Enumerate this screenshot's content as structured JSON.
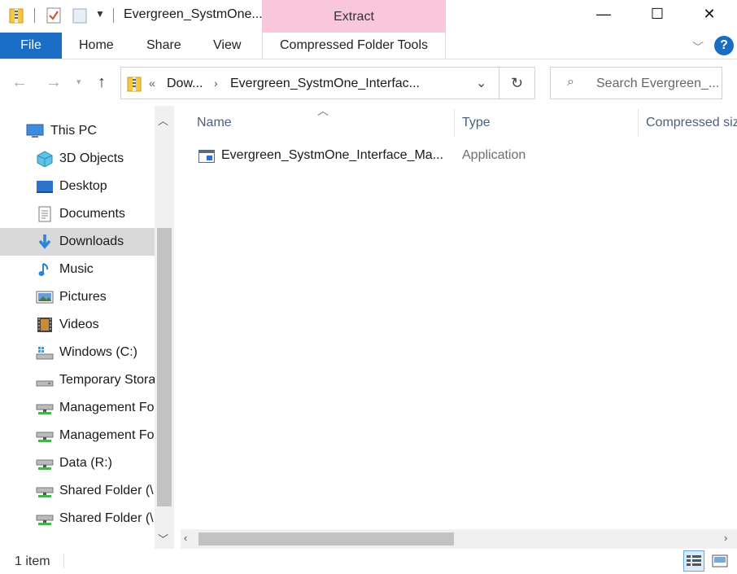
{
  "window": {
    "title": "Evergreen_SystmOne...",
    "contextual_group": "Extract",
    "contextual_color": "#f9c6dc",
    "controls": {
      "minimize": "—",
      "maximize": "☐",
      "close": "✕"
    }
  },
  "ribbon": {
    "file": "File",
    "tabs": [
      "Home",
      "Share",
      "View"
    ],
    "contextual_tab": "Compressed Folder Tools",
    "accent": "#1a6cc5",
    "help": "?"
  },
  "address": {
    "overflow": "«",
    "crumbs": [
      "Dow...",
      "Evergreen_SystmOne_Interfac..."
    ],
    "search_placeholder": "Search Evergreen_..."
  },
  "nav": {
    "items": [
      {
        "label": "This PC",
        "icon": "this-pc-icon"
      },
      {
        "label": "3D Objects",
        "icon": "3d-objects-icon"
      },
      {
        "label": "Desktop",
        "icon": "desktop-icon"
      },
      {
        "label": "Documents",
        "icon": "documents-icon"
      },
      {
        "label": "Downloads",
        "icon": "downloads-icon",
        "selected": true
      },
      {
        "label": "Music",
        "icon": "music-icon"
      },
      {
        "label": "Pictures",
        "icon": "pictures-icon"
      },
      {
        "label": "Videos",
        "icon": "videos-icon"
      },
      {
        "label": "Windows (C:)",
        "icon": "windows-drive-icon"
      },
      {
        "label": "Temporary Stora",
        "icon": "drive-icon"
      },
      {
        "label": "Management Fo",
        "icon": "network-drive-icon"
      },
      {
        "label": "Management Fo",
        "icon": "network-drive-icon"
      },
      {
        "label": "Data (R:)",
        "icon": "network-drive-icon"
      },
      {
        "label": "Shared Folder (\\",
        "icon": "network-drive-icon"
      },
      {
        "label": "Shared Folder (\\",
        "icon": "network-drive-icon"
      }
    ]
  },
  "content": {
    "columns": [
      "Name",
      "Type",
      "Compressed siz"
    ],
    "files": [
      {
        "name": "Evergreen_SystmOne_Interface_Ma...",
        "type": "Application",
        "icon": "application-icon"
      }
    ]
  },
  "status": {
    "count": "1 item"
  }
}
